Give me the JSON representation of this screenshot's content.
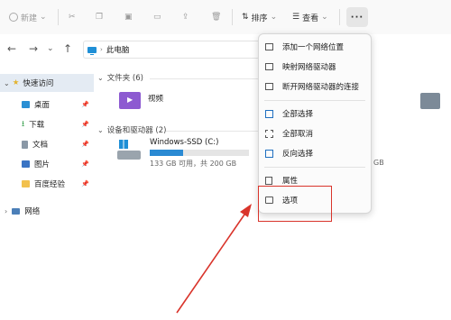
{
  "toolbar": {
    "new_label": "新建",
    "sort_label": "排序",
    "view_label": "查看",
    "more_label": "···"
  },
  "address": {
    "path": "此电脑"
  },
  "sidebar": {
    "quick_access": "快速访问",
    "items": [
      {
        "label": "桌面"
      },
      {
        "label": "下载"
      },
      {
        "label": "文档"
      },
      {
        "label": "图片"
      },
      {
        "label": "百度经验"
      }
    ],
    "network": "网络"
  },
  "content": {
    "folders_header": "文件夹 (6)",
    "video_label": "视频",
    "devices_header": "设备和驱动器 (2)",
    "drive_name": "Windows-SSD (C:)",
    "drive_info": "133 GB 可用，共 200 GB",
    "drive_usage": 0.335,
    "drive2_info_fragment": "GB"
  },
  "menu": {
    "items": [
      {
        "label": "添加一个网络位置",
        "icon": "network-add-icon"
      },
      {
        "label": "映射网络驱动器",
        "icon": "map-drive-icon"
      },
      {
        "label": "断开网络驱动器的连接",
        "icon": "disconnect-drive-icon"
      },
      {
        "label": "全部选择",
        "icon": "select-all-icon"
      },
      {
        "label": "全部取消",
        "icon": "select-none-icon"
      },
      {
        "label": "反向选择",
        "icon": "invert-selection-icon"
      },
      {
        "label": "属性",
        "icon": "properties-icon"
      },
      {
        "label": "选项",
        "icon": "options-icon"
      }
    ]
  },
  "annotation": {
    "color": "#d9342b"
  }
}
